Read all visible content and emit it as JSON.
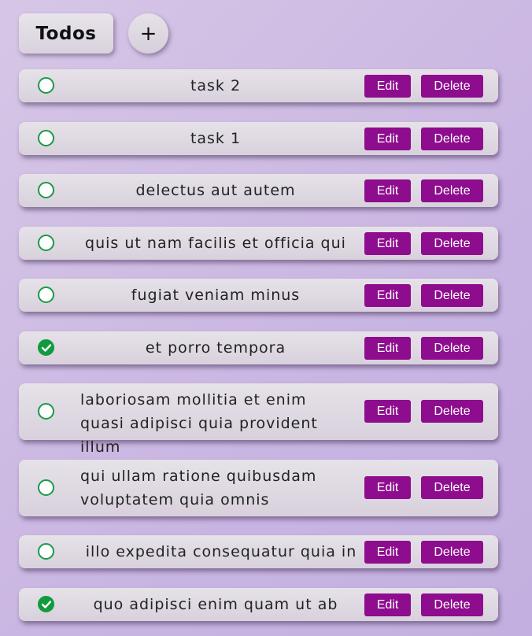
{
  "app": {
    "title": "Todos",
    "add_label": "+"
  },
  "actions": {
    "edit_label": "Edit",
    "delete_label": "Delete"
  },
  "colors": {
    "button": "#8e0c8e",
    "check": "#129a3e"
  },
  "todos": [
    {
      "text": "task 2",
      "completed": false
    },
    {
      "text": "task 1",
      "completed": false
    },
    {
      "text": "delectus aut autem",
      "completed": false
    },
    {
      "text": "quis ut nam facilis et officia qui",
      "completed": false
    },
    {
      "text": "fugiat veniam minus",
      "completed": false
    },
    {
      "text": "et porro tempora",
      "completed": true
    },
    {
      "text": "laboriosam mollitia et enim quasi adipisci quia provident illum",
      "completed": false
    },
    {
      "text": "qui ullam ratione quibusdam voluptatem quia omnis",
      "completed": false
    },
    {
      "text": "illo expedita consequatur quia in",
      "completed": false
    },
    {
      "text": "quo adipisci enim quam ut ab",
      "completed": true
    }
  ]
}
